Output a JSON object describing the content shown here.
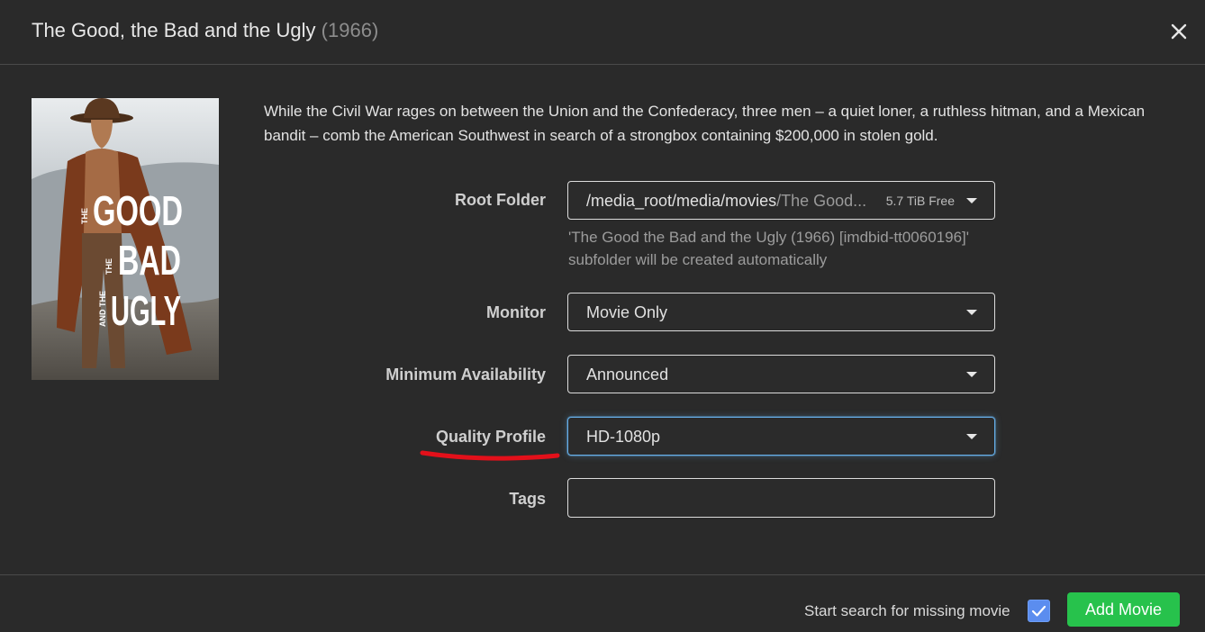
{
  "dialog": {
    "title": "The Good, the Bad and the Ugly",
    "year": "(1966)",
    "close_icon": "close-icon"
  },
  "poster": {
    "words": [
      "THE",
      "GOOD",
      "THE",
      "BAD",
      "AND THE",
      "UGLY"
    ],
    "colors": {
      "sky": "#9aa3a8",
      "ground": "#6e6a62",
      "poncho": "#7a3a1c",
      "text": "#ffffff"
    }
  },
  "overview": "While the Civil War rages on between the Union and the Confederacy, three men – a quiet loner, a ruthless hitman, and a Mexican bandit – comb the American Southwest in search of a strongbox containing $200,000 in stolen gold.",
  "form": {
    "root_folder": {
      "label": "Root Folder",
      "path": "/media_root/media/movies",
      "subpath": "/The Good...",
      "free": "5.7 TiB Free",
      "help": "'The Good the Bad and the Ugly (1966) [imdbid-tt0060196]' subfolder will be created automatically"
    },
    "monitor": {
      "label": "Monitor",
      "value": "Movie Only"
    },
    "minimum_availability": {
      "label": "Minimum Availability",
      "value": "Announced"
    },
    "quality_profile": {
      "label": "Quality Profile",
      "value": "HD-1080p"
    },
    "tags": {
      "label": "Tags",
      "value": ""
    }
  },
  "footer": {
    "search_label": "Start search for missing movie",
    "search_checked": true,
    "add_label": "Add Movie"
  },
  "colors": {
    "background": "#2a2a2a",
    "accent": "#5b8def",
    "add_button": "#27c24c",
    "annotation": "#e3101a",
    "focus": "#66afe9"
  }
}
